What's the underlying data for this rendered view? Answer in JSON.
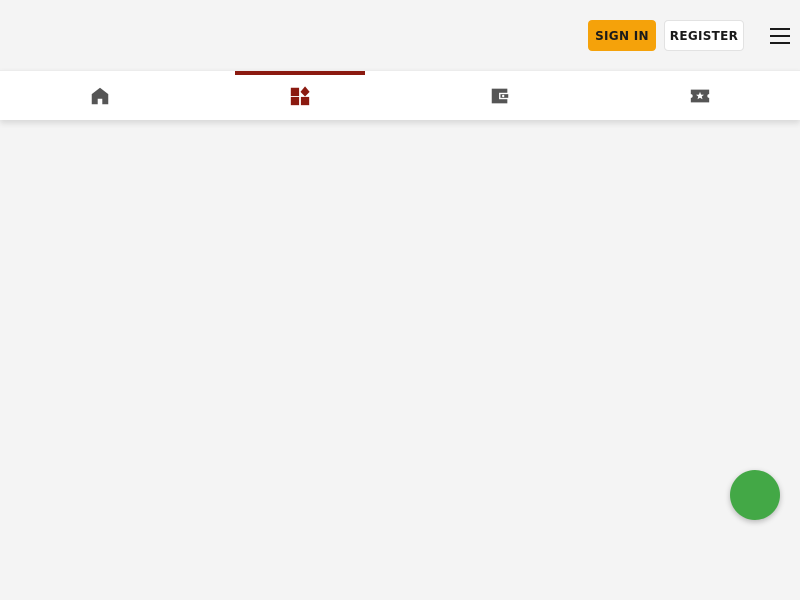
{
  "header": {
    "signin_label": "SIGN IN",
    "register_label": "REGISTER",
    "menu_icon": "hamburger-menu-icon"
  },
  "nav": {
    "tabs": [
      {
        "name": "home",
        "icon": "home-icon",
        "active": false
      },
      {
        "name": "games",
        "icon": "grid-diamond-icon",
        "active": true
      },
      {
        "name": "wallet",
        "icon": "wallet-icon",
        "active": false
      },
      {
        "name": "promotions",
        "icon": "ticket-star-icon",
        "active": false
      }
    ]
  },
  "colors": {
    "accent": "#8b1a10",
    "signin_bg": "#f5a20a",
    "icon_default": "#555555",
    "fab": "#43a846",
    "background": "#f4f4f4"
  },
  "fab": {
    "icon": "chat-icon"
  }
}
